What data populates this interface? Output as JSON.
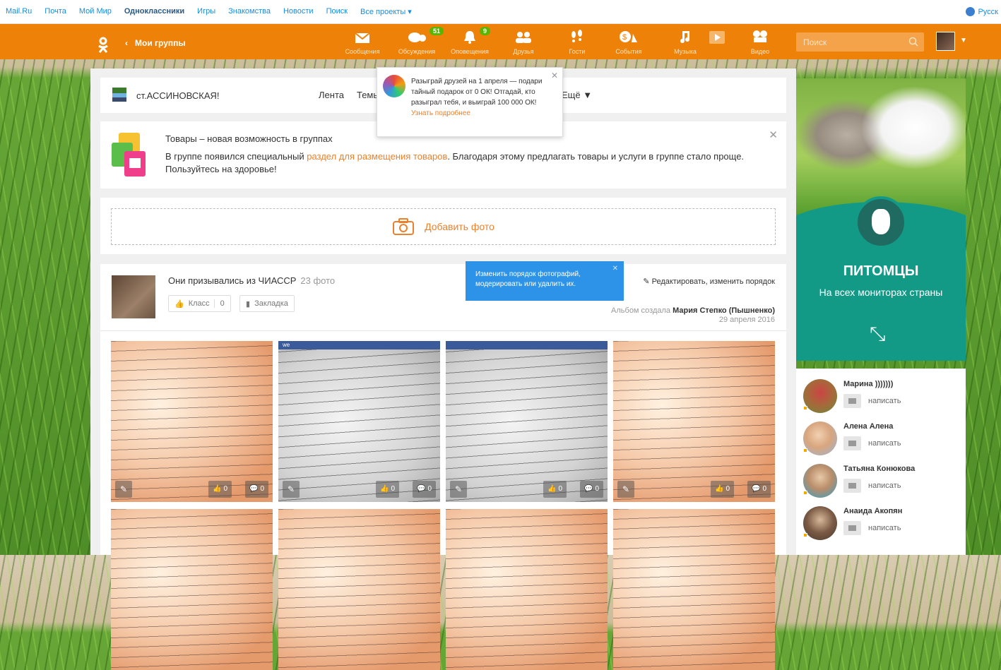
{
  "toolbar": {
    "links": [
      "Mail.Ru",
      "Почта",
      "Мой Мир",
      "Одноклассники",
      "Игры",
      "Знакомства",
      "Новости",
      "Поиск",
      "Все проекты ▾"
    ],
    "language": "Русск"
  },
  "header": {
    "back_label": "Мои группы",
    "nav": [
      {
        "label": "Сообщения",
        "icon": "envelope-icon"
      },
      {
        "label": "Обсуждения",
        "icon": "chat-icon",
        "badge": "51"
      },
      {
        "label": "Оповещения",
        "icon": "bell-icon",
        "badge": "9"
      },
      {
        "label": "Друзья",
        "icon": "friends-icon"
      },
      {
        "label": "Гости",
        "icon": "footprints-icon"
      },
      {
        "label": "События",
        "icon": "events-icon"
      },
      {
        "label": "Музыка",
        "icon": "music-icon"
      },
      {
        "label": "Видео",
        "icon": "video-icon"
      }
    ],
    "search_placeholder": "Поиск",
    "brand_color": "#ee8208"
  },
  "group": {
    "name": "ст.АССИНОВСКАЯ!",
    "tabs": [
      "Лента",
      "Темы"
    ],
    "more": "Ещё ▼"
  },
  "notification": {
    "text": "Разыграй друзей на 1 апреля — подари тайный подарок от 0 ОК! Отгадай, кто разыграл тебя, и выиграй 100 000 ОК!",
    "link": "Узнать подробнее"
  },
  "promo": {
    "title": "Товары – новая возможность в группах",
    "text_before": "В группе появился специальный ",
    "link": "раздел для размещения товаров",
    "text_after": ". Благодаря этому предлагать товары и услуги в группе стало проще. Пользуйтесь на здоровье!"
  },
  "add_photo": "Добавить фото",
  "album": {
    "title": "Они призывались из ЧИАССР",
    "count": "23 фото",
    "class_label": "Класс",
    "class_count": "0",
    "bookmark_label": "Закладка",
    "edit_label": "Редактировать, изменить порядок",
    "created_by_label": "Альбом создала",
    "creator": "Мария Степко (Пышненко)",
    "date": "29 апреля 2016",
    "photo_bar": "we",
    "like_count": "0",
    "comment_count": "0"
  },
  "tooltip": "Изменить порядок фотографий, модерировать или удалить их.",
  "banner": {
    "title": "ПИТОМЦЫ",
    "subtitle": "На всех мониторах страны",
    "bg_color": "#139a87"
  },
  "friends": [
    {
      "name": "Марина )))))))",
      "action": "написать"
    },
    {
      "name": "Алена Алена",
      "action": "написать"
    },
    {
      "name": "Татьяна Конюкова",
      "action": "написать"
    },
    {
      "name": "Анаида Акопян",
      "action": "написать"
    }
  ]
}
